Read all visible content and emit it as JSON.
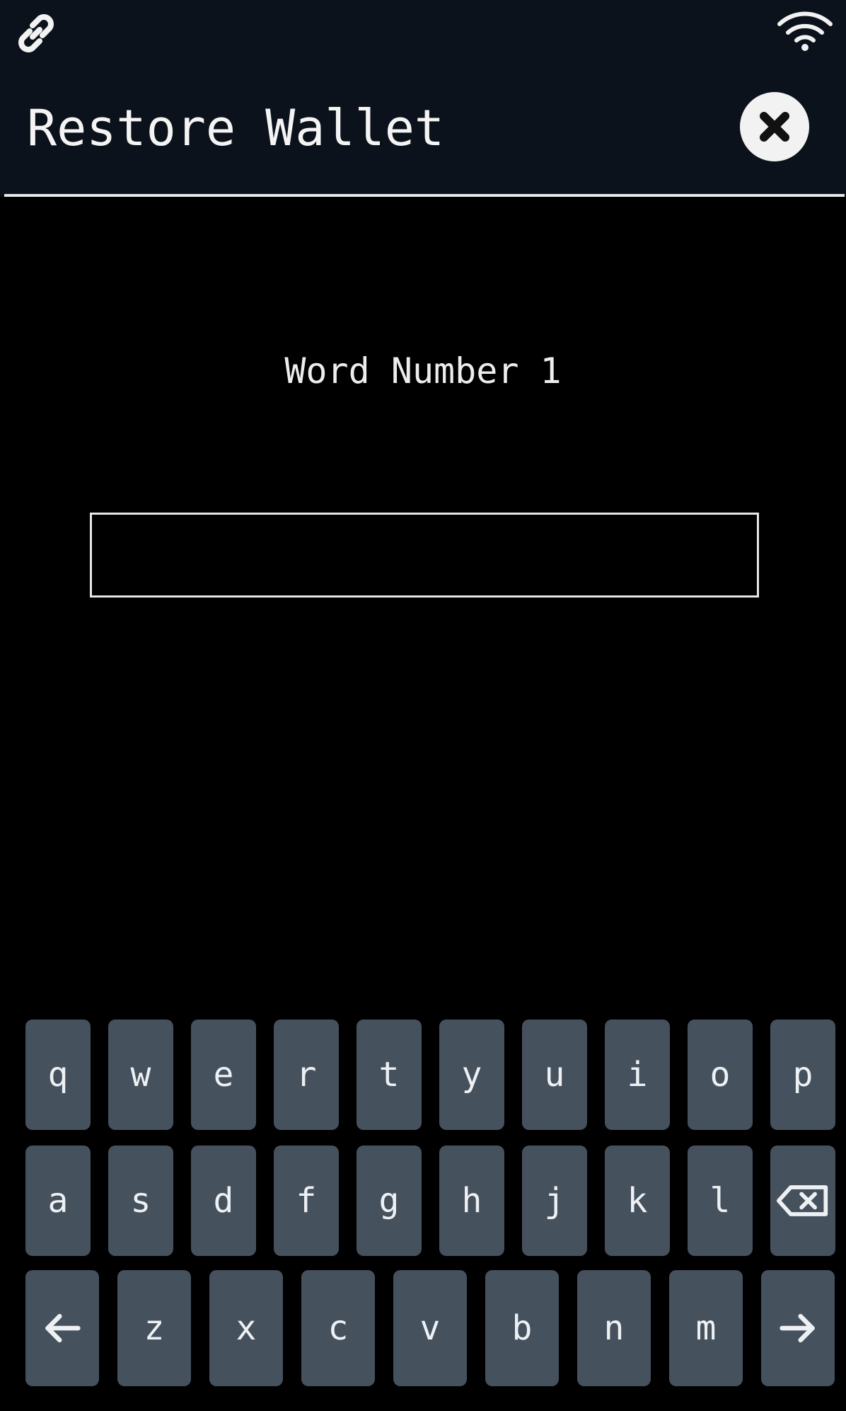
{
  "status_bar": {
    "left_icon": "link-icon",
    "right_icon": "wifi-icon"
  },
  "header": {
    "title": "Restore Wallet",
    "close_icon": "close-icon"
  },
  "main": {
    "prompt": "Word Number 1",
    "input_value": ""
  },
  "keyboard": {
    "row1": [
      "q",
      "w",
      "e",
      "r",
      "t",
      "y",
      "u",
      "i",
      "o",
      "p"
    ],
    "row2": [
      "a",
      "s",
      "d",
      "f",
      "g",
      "h",
      "j",
      "k",
      "l"
    ],
    "row2_end_icon": "backspace-icon",
    "row3_start_icon": "arrow-left-icon",
    "row3": [
      "z",
      "x",
      "c",
      "v",
      "b",
      "n",
      "m"
    ],
    "row3_end_icon": "arrow-right-icon"
  },
  "colors": {
    "background": "#000000",
    "header_background": "#0c121b",
    "key_background": "#46515e",
    "text": "#f2f2f2"
  }
}
